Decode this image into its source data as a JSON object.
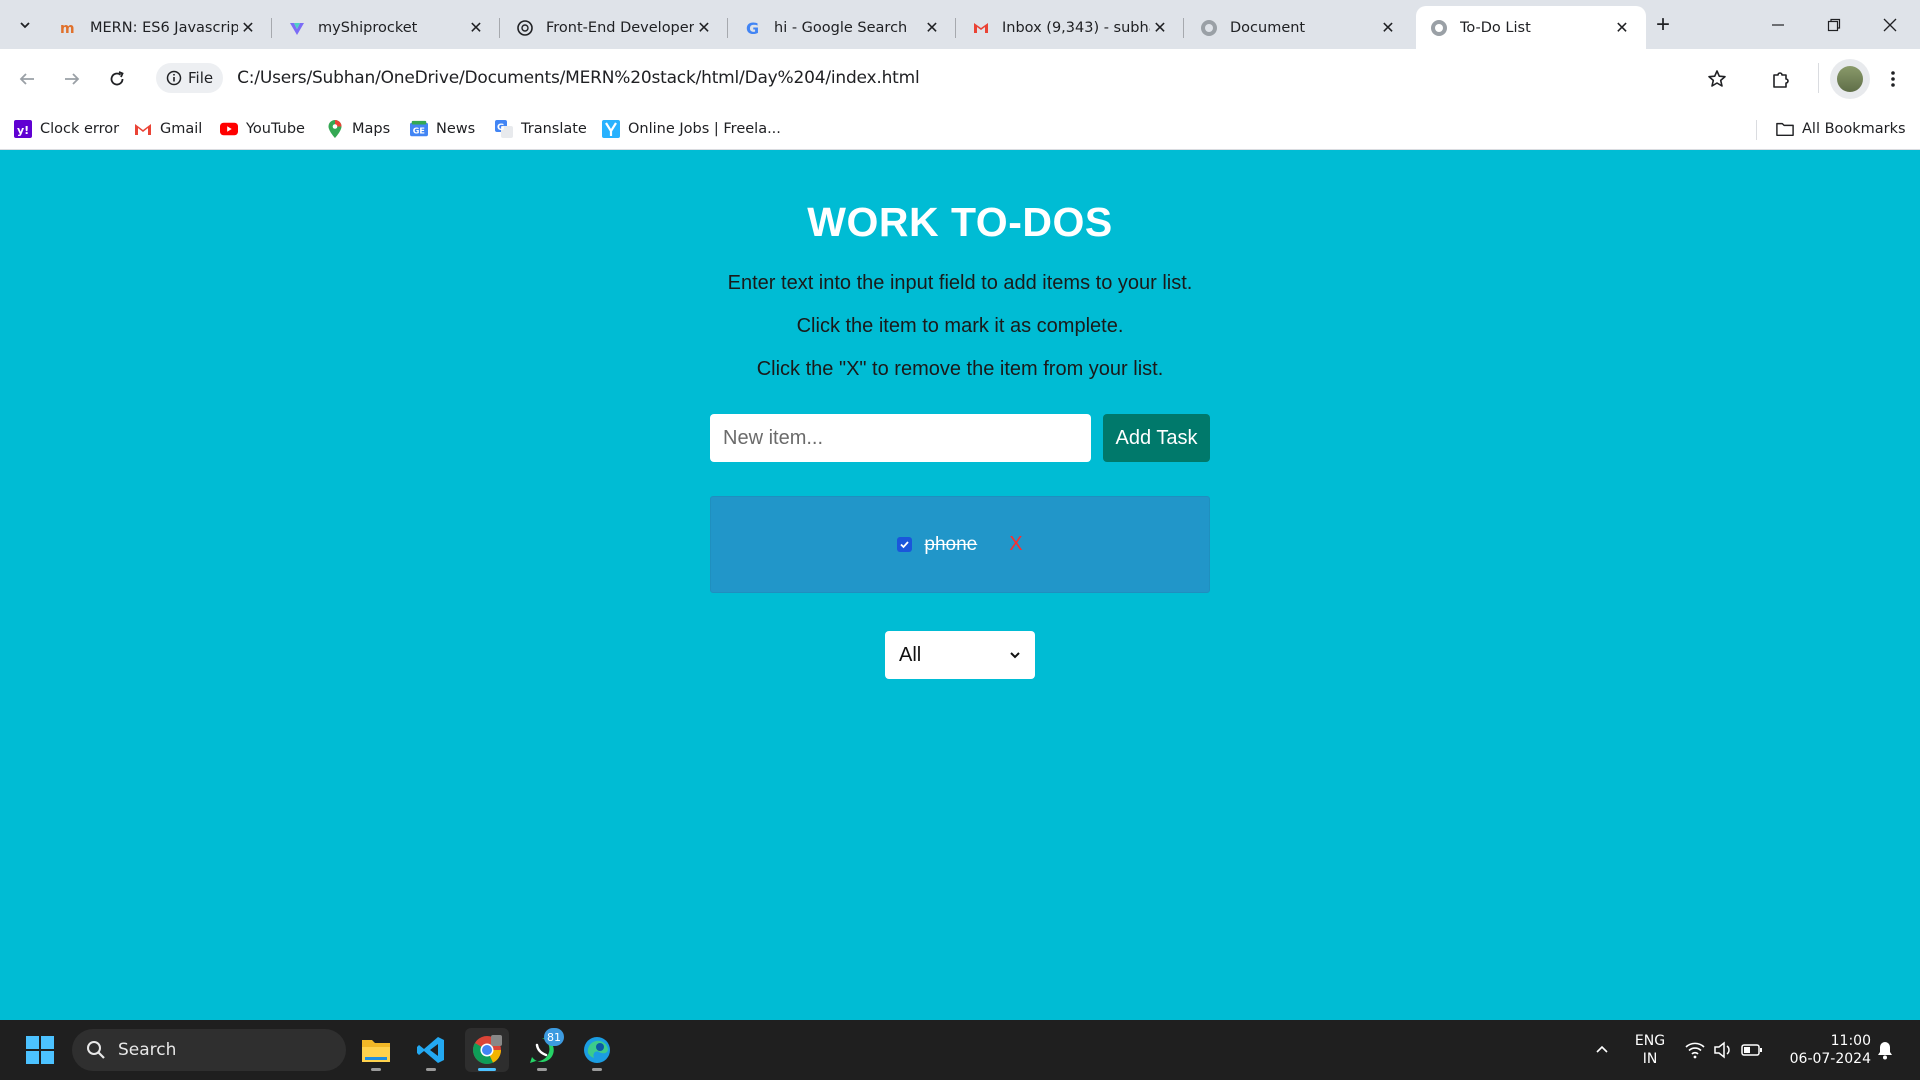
{
  "browser": {
    "tabs": [
      {
        "title": "MERN: ES6 Javascript",
        "icon": "mern-favicon"
      },
      {
        "title": "myShiprocket",
        "icon": "shiprocket-favicon"
      },
      {
        "title": "Front-End Developer",
        "icon": "chatgpt-favicon"
      },
      {
        "title": "hi - Google Search",
        "icon": "google-favicon"
      },
      {
        "title": "Inbox (9,343) - subha",
        "icon": "gmail-favicon"
      },
      {
        "title": "Document",
        "icon": "globe-favicon"
      },
      {
        "title": "To-Do List",
        "icon": "globe-favicon",
        "active": true
      }
    ],
    "address": {
      "chip_label": "File",
      "url": "C:/Users/Subhan/OneDrive/Documents/MERN%20stack/html/Day%204/index.html"
    },
    "bookmarks": [
      {
        "label": "Clock error",
        "icon": "yahoo-icon"
      },
      {
        "label": "Gmail",
        "icon": "gmail-icon"
      },
      {
        "label": "YouTube",
        "icon": "youtube-icon"
      },
      {
        "label": "Maps",
        "icon": "maps-icon"
      },
      {
        "label": "News",
        "icon": "news-icon"
      },
      {
        "label": "Translate",
        "icon": "translate-icon"
      },
      {
        "label": "Online Jobs | Freela...",
        "icon": "freelancer-icon"
      }
    ],
    "all_bookmarks_label": "All Bookmarks"
  },
  "page": {
    "title": "WORK TO-DOS",
    "instructions": [
      "Enter text into the input field to add items to your list.",
      "Click the item to mark it as complete.",
      "Click the \"X\" to remove the item from your list."
    ],
    "input_placeholder": "New item...",
    "add_button_label": "Add Task",
    "todos": [
      {
        "text": "phone",
        "completed": true,
        "delete_label": "X"
      }
    ],
    "filter": {
      "selected": "All"
    }
  },
  "taskbar": {
    "search_label": "Search",
    "whatsapp_badge": "81",
    "language": {
      "line1": "ENG",
      "line2": "IN"
    },
    "time": "11:00",
    "date": "06-07-2024"
  },
  "colors": {
    "page_background": "#00BCD4",
    "add_button": "#00796B",
    "list_panel": "#2196C9",
    "delete_x": "#FF2D2D"
  }
}
